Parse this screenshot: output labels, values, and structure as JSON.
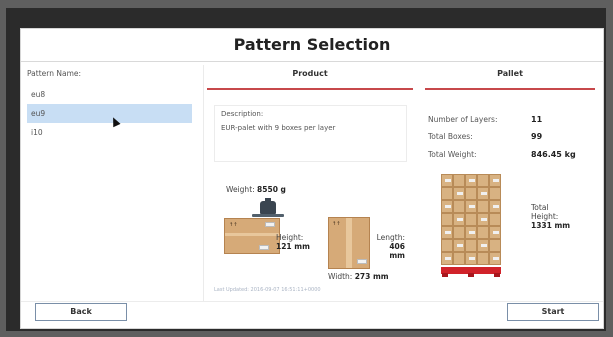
{
  "title": "Pattern Selection",
  "patterns": {
    "label": "Pattern Name:",
    "items": [
      "eu8",
      "eu9",
      "i10"
    ],
    "selected_index": 1
  },
  "product": {
    "header": "Product",
    "description_label": "Description:",
    "description": "EUR-palet with 9 boxes per layer",
    "weight_label": "Weight:",
    "weight_value": "8550 g",
    "height_label": "Height:",
    "height_value": "121 mm",
    "length_label": "Length:",
    "length_value": "406 mm",
    "width_label": "Width:",
    "width_value": "273 mm",
    "last_updated": "Last Updated: 2016-09-07 16:51:11+0000"
  },
  "pallet": {
    "header": "Pallet",
    "layers_label": "Number of Layers:",
    "layers_value": "11",
    "boxes_label": "Total Boxes:",
    "boxes_value": "99",
    "weight_label": "Total Weight:",
    "weight_value": "846.45 kg",
    "height_label_1": "Total",
    "height_label_2": "Height:",
    "height_value": "1331 mm"
  },
  "buttons": {
    "back": "Back",
    "start": "Start"
  },
  "colors": {
    "accent": "#c7484b",
    "selected_row": "#c8def4",
    "pallet_red": "#d1222a",
    "box_brown": "#d6aa78"
  }
}
